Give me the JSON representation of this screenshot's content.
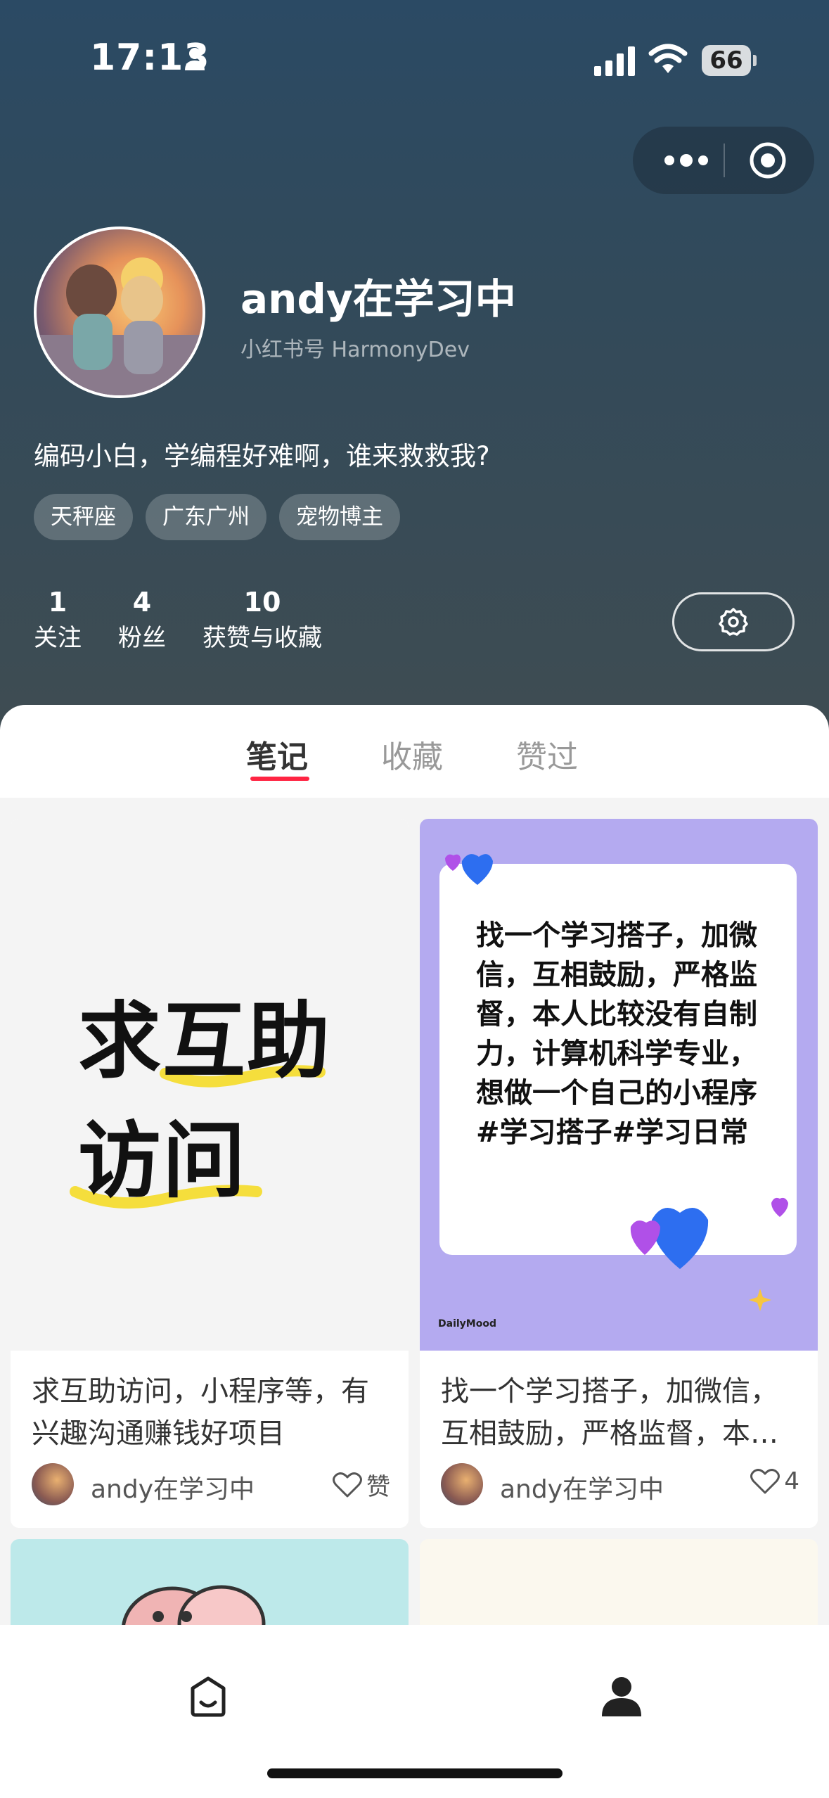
{
  "status": {
    "time": "17:13",
    "battery": "66"
  },
  "profile": {
    "name": "andy在学习中",
    "id_text": "小红书号 HarmonyDev",
    "bio": "编码小白，学编程好难啊，谁来救救我?",
    "tags": [
      "天秤座",
      "广东广州",
      "宠物博主"
    ],
    "stats": [
      {
        "num": "1",
        "label": "关注"
      },
      {
        "num": "4",
        "label": "粉丝"
      },
      {
        "num": "10",
        "label": "获赞与收藏"
      }
    ]
  },
  "tabs": [
    "笔记",
    "收藏",
    "赞过"
  ],
  "notes": [
    {
      "cover_lines": [
        "求互助",
        "访问"
      ],
      "title": "求互助访问，小程序等，有兴趣沟通赚钱好项目",
      "author": "andy在学习中",
      "like": "赞"
    },
    {
      "cover_text": "找一个学习搭子，加微信，互相鼓励，严格监督，本人比较没有自制力，计算机科学专业，想做一个自己的小程序 #学习搭子#学习日常",
      "brand": "DailyMood",
      "title": "找一个学习搭子，加微信，互相鼓励，严格监督，本人比较没有自制力",
      "author": "andy在学习中",
      "like": "4"
    }
  ],
  "colors": {
    "accent": "#ff2442",
    "cover_purple": "#b4aaf0"
  }
}
